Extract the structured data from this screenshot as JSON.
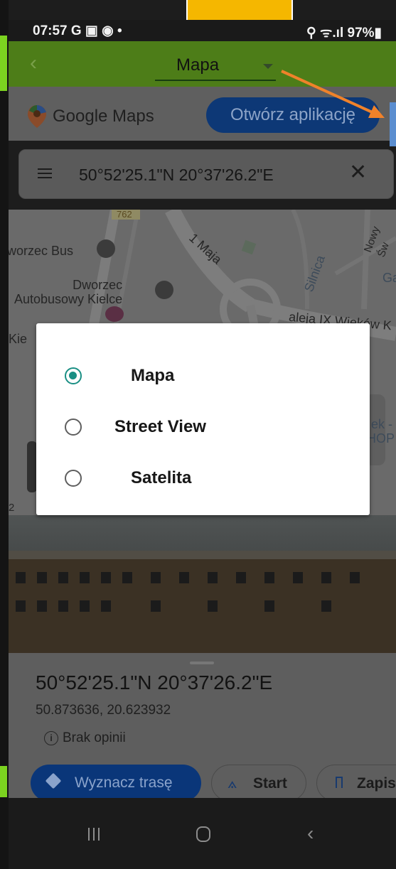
{
  "status_bar": {
    "time": "07:57 G ▣ ◉ •",
    "right": "⚲ ᯤ.ıl 97%▮"
  },
  "app_bar": {
    "back_label": "‹",
    "dropdown_label": "Mapa"
  },
  "gmaps_bar": {
    "title": "Google Maps",
    "open_app_label": "Otwórz aplikację"
  },
  "search": {
    "value": "50°52'25.1\"N 20°37'26.2\"E",
    "clear_label": "✕"
  },
  "map": {
    "labels": {
      "road_762": "762",
      "bus_station_short": "worzec Bus",
      "bus_station": "Dworzec\nAutobusowy Kielce",
      "street_1maja": "1 Maja",
      "street_silnica": "Silnica",
      "street_nowy": "Nowy Św",
      "aleja": "aleja IX Wieków K",
      "ga": "Ga",
      "kie": "Kie",
      "ek": "ek -",
      "hop": "HOP",
      "num2": "2"
    }
  },
  "dialog": {
    "options": [
      {
        "label": "Mapa",
        "selected": true
      },
      {
        "label": "Street View",
        "selected": false
      },
      {
        "label": "Satelita",
        "selected": false
      }
    ]
  },
  "place": {
    "title": "50°52'25.1\"N 20°37'26.2\"E",
    "latlng": "50.873636, 20.623932",
    "reviews": "Brak opinii",
    "route_label": "Wyznacz trasę",
    "start_label": "Start",
    "save_label": "Zapisz"
  },
  "colors": {
    "accent_green": "#1a8f84",
    "arrow": "#f0822a",
    "highlight": "#f5b700",
    "brand_blue": "#0d3876"
  }
}
